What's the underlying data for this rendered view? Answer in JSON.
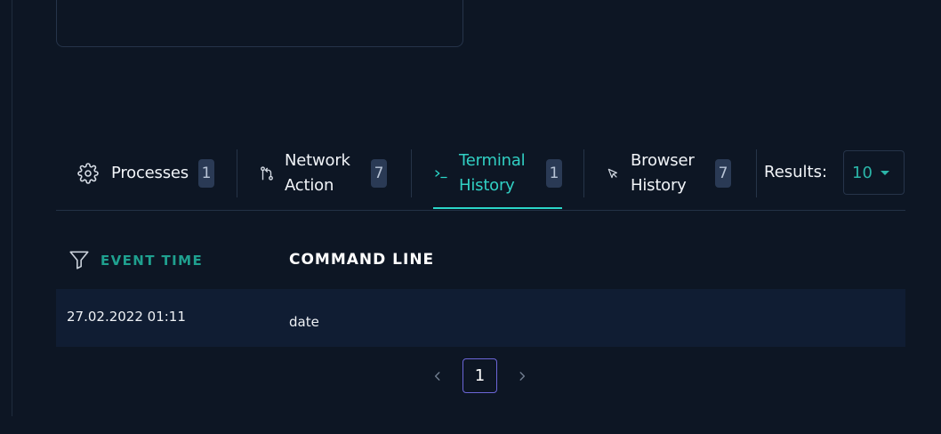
{
  "tabs": [
    {
      "icon": "gear-icon",
      "label": "Processes",
      "count": "1"
    },
    {
      "icon": "git-branch-icon",
      "label": "Network Action",
      "count": "7"
    },
    {
      "icon": "terminal-icon",
      "label": "Terminal History",
      "count": "1"
    },
    {
      "icon": "cursor-arrow-icon",
      "label": "Browser History",
      "count": "7"
    }
  ],
  "active_tab": "Terminal History",
  "results": {
    "label": "Results:",
    "value": "10"
  },
  "table": {
    "columns": [
      "EVENT TIME",
      "COMMAND LINE"
    ],
    "rows": [
      {
        "event_time": "27.02.2022 01:11",
        "command_line": "date"
      }
    ]
  },
  "pagination": {
    "current": "1"
  },
  "colors": {
    "accent": "#2ad6c8",
    "background": "#0d1624",
    "row": "#101d33",
    "pager_border": "#6c66d8"
  }
}
